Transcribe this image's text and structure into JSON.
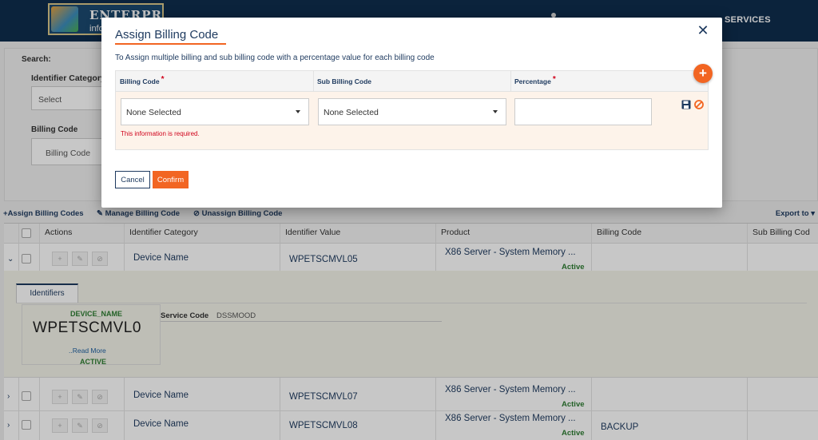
{
  "app": {
    "logo_line1": "ENTERPRISE",
    "logo_line2": "info",
    "nav_services": "SERVICES"
  },
  "search_panel": {
    "search_label": "Search:",
    "identifier_category_label": "Identifier Category",
    "identifier_category_value": "Select",
    "billing_code_label": "Billing Code",
    "billing_code_placeholder": "Billing Code"
  },
  "toolbar": {
    "assign": "Assign Billing Codes",
    "manage": "Manage Billing Code",
    "unassign": "Unassign Billing Code",
    "export": "Export to"
  },
  "grid": {
    "columns": [
      "Actions",
      "Identifier Category",
      "Identifier Value",
      "Product",
      "Billing Code",
      "Sub Billing Cod"
    ],
    "rows": [
      {
        "category": "Device Name",
        "value": "WPETSCMVL05",
        "product": "X86 Server - System Memory ...",
        "status": "Active",
        "billing_code": ""
      },
      {
        "category": "Device Name",
        "value": "WPETSCMVL07",
        "product": "X86 Server - System Memory ...",
        "status": "Active",
        "billing_code": ""
      },
      {
        "category": "Device Name",
        "value": "WPETSCMVL08",
        "product": "X86 Server - System Memory ...",
        "status": "Active",
        "billing_code": "BACKUP"
      }
    ],
    "detail": {
      "tab": "Identifiers",
      "card_title": "DEVICE_NAME",
      "card_value": "WPETSCMVL0",
      "read_more": "..Read More",
      "card_status": "ACTIVE",
      "service_code_label": "Service Code",
      "service_code_value": "DSSMOOD"
    }
  },
  "modal": {
    "title": "Assign Billing Code",
    "description": "To Assign multiple billing and sub billing code with a percentage value for each billing code",
    "columns": {
      "billing_code": "Billing Code",
      "sub_billing_code": "Sub Billing Code",
      "percentage": "Percentage"
    },
    "required_mark": "*",
    "billing_code_value": "None Selected",
    "sub_billing_code_value": "None Selected",
    "percentage_value": "",
    "error_text": "This information is required.",
    "cancel_label": "Cancel",
    "confirm_label": "Confirm",
    "accent_color": "#f26522",
    "primary_color": "#1e3a5f"
  }
}
